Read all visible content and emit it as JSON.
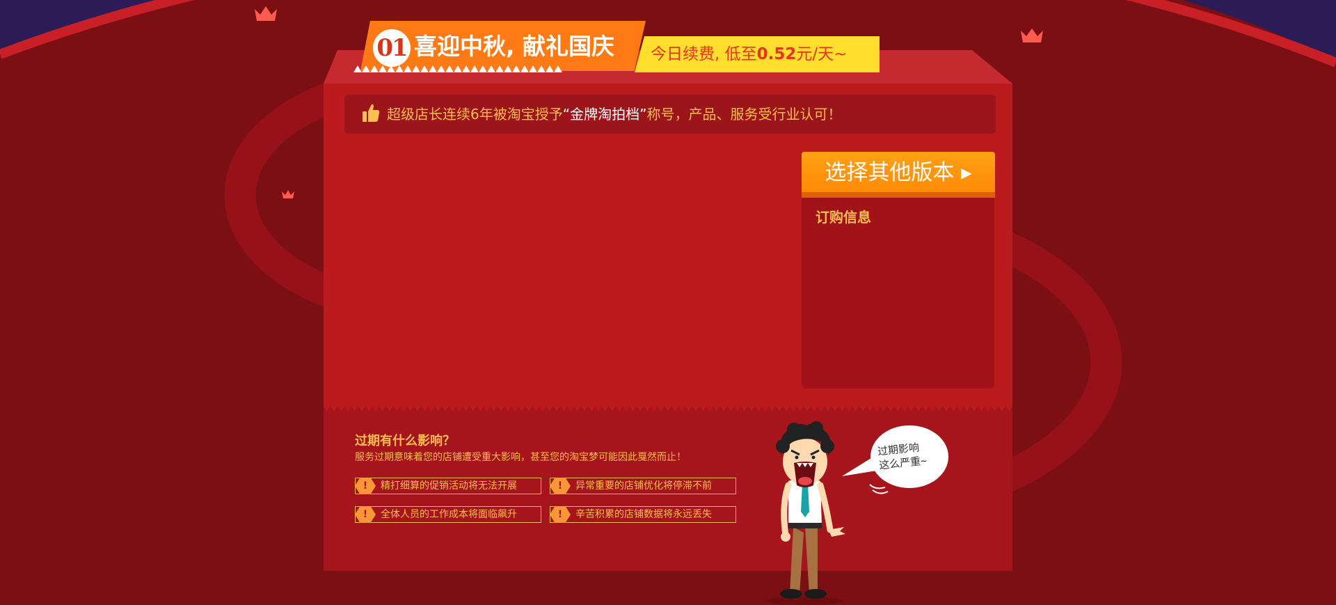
{
  "banner": {
    "number": "01",
    "title": "喜迎中秋, 献礼国庆",
    "subtitle_prefix": "今日续费, 低至",
    "subtitle_price": "0.52",
    "subtitle_suffix": "元/天~"
  },
  "notice": {
    "prefix": "超级店长连续6年被淘宝授予",
    "highlight": "“金牌淘拍档”",
    "suffix": "称号，产品、服务受行业认可！"
  },
  "select_button": {
    "label": "选择其他版本"
  },
  "order_panel": {
    "title": "订购信息"
  },
  "expiry": {
    "title": "过期有什么影响？",
    "description": "服务过期意味着您的店铺遭受重大影响，甚至您的淘宝梦可能因此戛然而止！",
    "warnings": [
      "精打细算的促销活动将无法开展",
      "异常重要的店铺优化将停滞不前",
      "全体人员的工作成本将面临飙升",
      "辛苦积累的店铺数据将永远丢失"
    ],
    "bubble_text": "过期影响\n这么严重~"
  },
  "colors": {
    "background": "#7c0f14",
    "box": "#bc1b1e",
    "accent_orange": "#ff7a14",
    "accent_yellow": "#ffde2e",
    "text_gold": "#ffbe4f"
  }
}
